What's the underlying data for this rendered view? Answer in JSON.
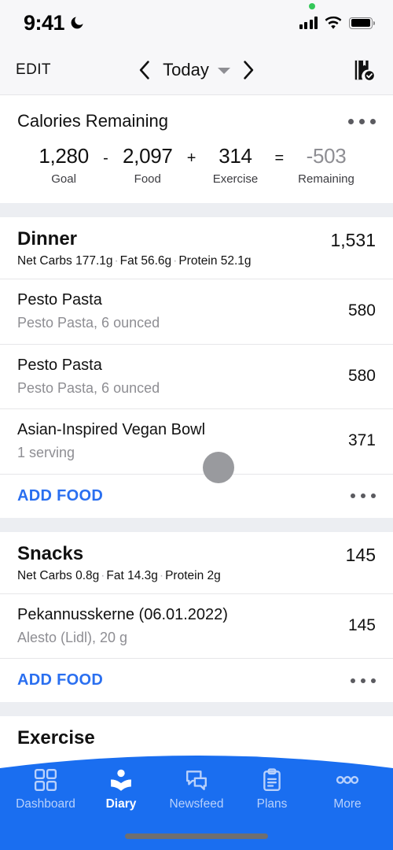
{
  "status_bar": {
    "time": "9:41",
    "moon_icon": "moon-icon",
    "green_dot": "recording-indicator-dot",
    "signal_icon": "cellular-signal-icon",
    "wifi_icon": "wifi-icon",
    "battery_icon": "battery-full-icon"
  },
  "nav_bar": {
    "edit_label": "EDIT",
    "prev_icon": "chevron-left-icon",
    "date_label": "Today",
    "caret_icon": "chevron-down-icon",
    "next_icon": "chevron-right-icon",
    "journal_icon": "journal-check-icon"
  },
  "calories_card": {
    "title": "Calories Remaining",
    "menu_icon": "overflow-menu-icon",
    "goal_value": "1,280",
    "goal_label": "Goal",
    "op_minus": "-",
    "food_value": "2,097",
    "food_label": "Food",
    "op_plus": "+",
    "exercise_value": "314",
    "exercise_label": "Exercise",
    "op_equals": "=",
    "remaining_value": "-503",
    "remaining_label": "Remaining",
    "remaining_color": "#8e8e93"
  },
  "meals": [
    {
      "name": "Dinner",
      "calories": "1,531",
      "macros": {
        "net_carbs": "Net Carbs 177.1g",
        "fat": "Fat 56.6g",
        "protein": "Protein 52.1g"
      },
      "items": [
        {
          "name": "Pesto Pasta",
          "description": "Pesto Pasta, 6 ounced",
          "calories": "580"
        },
        {
          "name": "Pesto Pasta",
          "description": "Pesto Pasta, 6 ounced",
          "calories": "580"
        },
        {
          "name": "Asian-Inspired Vegan Bowl",
          "description": "1 serving",
          "calories": "371"
        }
      ],
      "add_food_label": "ADD FOOD",
      "menu_icon": "overflow-menu-icon"
    },
    {
      "name": "Snacks",
      "calories": "145",
      "macros": {
        "net_carbs": "Net Carbs 0.8g",
        "fat": "Fat 14.3g",
        "protein": "Protein 2g"
      },
      "items": [
        {
          "name": "Pekannusskerne (06.01.2022)",
          "description": "Alesto (Lidl), 20 g",
          "calories": "145"
        }
      ],
      "add_food_label": "ADD FOOD",
      "menu_icon": "overflow-menu-icon"
    },
    {
      "name": "Exercise",
      "calories": "",
      "macros": {
        "net_carbs": "",
        "fat": "",
        "protein": ""
      },
      "items": [],
      "add_food_label": "",
      "menu_icon": ""
    }
  ],
  "macro_separator": "·",
  "cursor": {
    "name": "touch-cursor-indicator",
    "color": "#999a9e"
  },
  "bottom_nav": {
    "background_color": "#1a6ef0",
    "active_tab": "Diary",
    "items": [
      {
        "label": "Dashboard",
        "icon": "grid-icon",
        "active": false
      },
      {
        "label": "Diary",
        "icon": "book-reader-icon",
        "active": true
      },
      {
        "label": "Newsfeed",
        "icon": "chat-bubbles-icon",
        "active": false
      },
      {
        "label": "Plans",
        "icon": "clipboard-icon",
        "active": false
      },
      {
        "label": "More",
        "icon": "more-dots-icon",
        "active": false
      }
    ],
    "home_indicator": "home-indicator-bar"
  }
}
